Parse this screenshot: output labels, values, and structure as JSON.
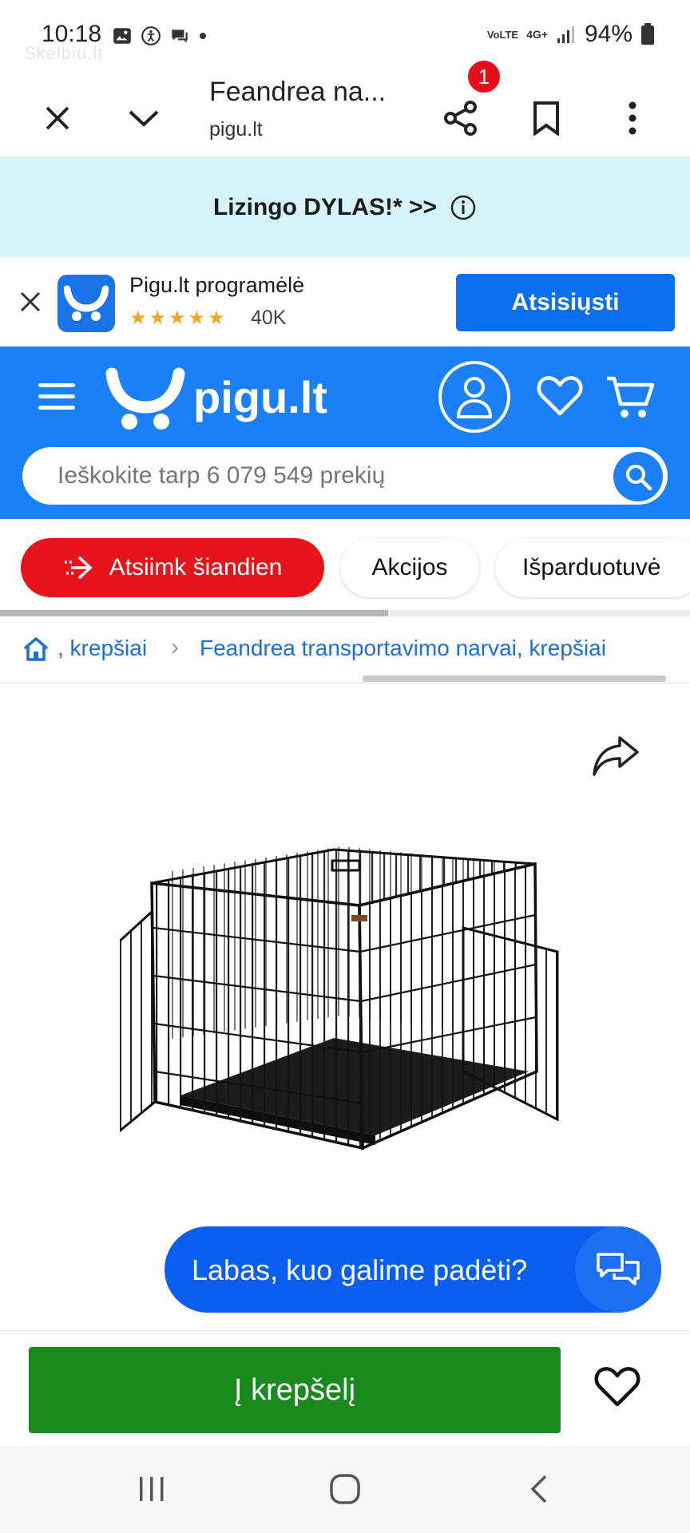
{
  "status_bar": {
    "time": "10:18",
    "battery": "94%",
    "network": "4G+",
    "lte": "VoLTE",
    "watermark": "Skelbiu.lt"
  },
  "browser": {
    "title": "Feandrea na...",
    "url": "pigu.lt"
  },
  "promo": {
    "text": "Lizingo DYLAS!* >>"
  },
  "app_banner": {
    "name": "Pigu.lt programėlė",
    "stars": "★★★★★",
    "rating_count": "40K",
    "download_label": "Atsisiųsti"
  },
  "header": {
    "logo_text": "pigu.lt",
    "search_placeholder": "Ieškokite tarp 6 079 549 prekių"
  },
  "quick_nav": {
    "items": [
      {
        "label": "Atsiimk šiandien"
      },
      {
        "label": "Akcijos"
      },
      {
        "label": "Išparduotuvė"
      }
    ]
  },
  "breadcrumb": {
    "items": [
      {
        "label": ", krepšiai"
      },
      {
        "label": "Feandrea transportavimo narvai, krepšiai"
      }
    ]
  },
  "chat": {
    "text": "Labas, kuo galime padėti?",
    "badge": "1"
  },
  "actions": {
    "add_to_cart": "Į krepšelį"
  },
  "colors": {
    "brand_blue": "#1b7ff5",
    "promo_bg": "#d6f5fa",
    "red": "#e8141c",
    "green": "#1a8a1e",
    "chat_blue": "#0b5ff0"
  }
}
